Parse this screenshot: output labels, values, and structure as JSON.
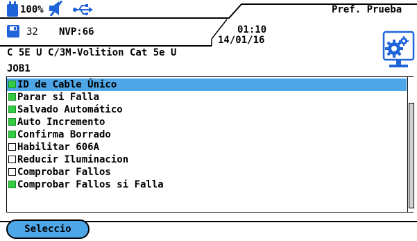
{
  "status": {
    "battery_label": "100%",
    "count": "32",
    "nvp": "NVP:66",
    "time": "01:10",
    "date": "14/01/16",
    "title": "Pref. Prueba"
  },
  "cable": {
    "type": "C 5E U C/3M-Volition Cat 5e U",
    "job": "JOB1"
  },
  "settings": [
    {
      "label": "ID de Cable Único",
      "checked": true,
      "selected": true
    },
    {
      "label": "Parar si Falla",
      "checked": true,
      "selected": false
    },
    {
      "label": "Salvado Automático",
      "checked": true,
      "selected": false
    },
    {
      "label": "Auto Incremento",
      "checked": true,
      "selected": false
    },
    {
      "label": "Confirma Borrado",
      "checked": true,
      "selected": false
    },
    {
      "label": "Habilitar 606A",
      "checked": false,
      "selected": false
    },
    {
      "label": "Reducir Iluminacion",
      "checked": false,
      "selected": false
    },
    {
      "label": "Comprobar Fallos",
      "checked": false,
      "selected": false
    },
    {
      "label": "Comprobar Fallos si Falla",
      "checked": true,
      "selected": false
    }
  ],
  "footer": {
    "select_label": "Seleccio"
  },
  "icons": {
    "battery": "battery-icon",
    "mute": "speaker-muted-icon",
    "usb": "usb-icon",
    "save": "floppy-disk-icon",
    "settings": "settings-gear-monitor-icon"
  },
  "colors": {
    "selection": "#4da6e8",
    "checked": "#33cc44"
  }
}
